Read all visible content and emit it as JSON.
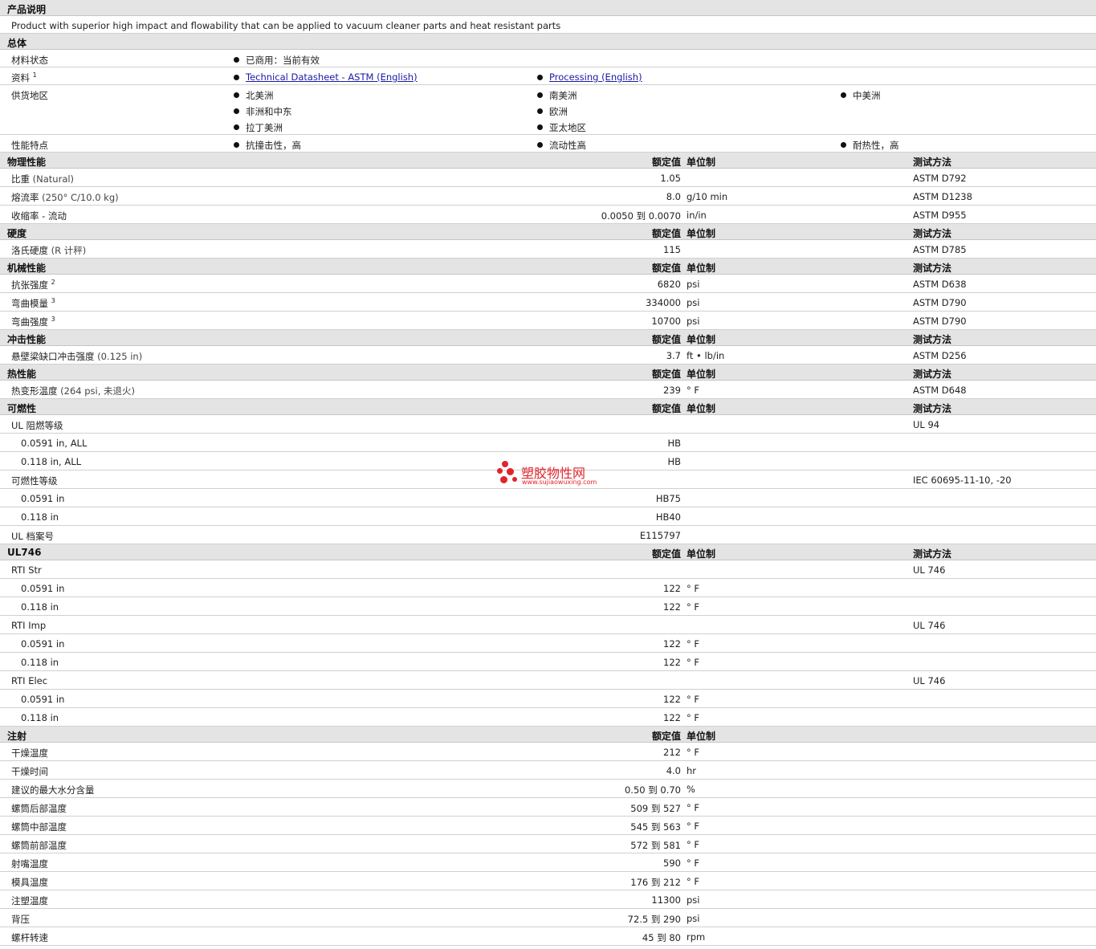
{
  "description": {
    "title": "产品说明",
    "text": "Product with superior high impact and flowability that can be applied to vacuum cleaner parts and heat resistant parts"
  },
  "general": {
    "title": "总体",
    "rows": [
      {
        "label": "材料状态",
        "sup": "",
        "items": [
          "已商用：当前有效"
        ],
        "links": false
      },
      {
        "label": "资料",
        "sup": "1",
        "items": [
          "Technical Datasheet - ASTM (English)",
          "Processing (English)"
        ],
        "links": true
      },
      {
        "label": "供货地区",
        "sup": "",
        "items": [
          "北美洲",
          "南美洲",
          "中美洲",
          "非洲和中东",
          "欧洲",
          "拉丁美洲",
          "亚太地区"
        ],
        "links": false,
        "order": [
          0,
          1,
          2,
          3,
          4,
          null,
          5,
          6
        ]
      },
      {
        "label": "性能特点",
        "sup": "",
        "items": [
          "抗撞击性，高",
          "流动性高",
          "耐热性，高"
        ],
        "links": false
      }
    ]
  },
  "columns": {
    "value": "额定值",
    "unit": "单位制",
    "method": "测试方法"
  },
  "sections": [
    {
      "title": "物理性能",
      "rows": [
        {
          "label": "比重",
          "note": "(Natural)",
          "value": "1.05",
          "unit": "",
          "method": "ASTM D792"
        },
        {
          "label": "熔流率",
          "note": "(250° C/10.0 kg)",
          "value": "8.0",
          "unit": "g/10 min",
          "method": "ASTM D1238"
        },
        {
          "label": "收缩率 - 流动",
          "note": "",
          "value": "0.0050 到 0.0070",
          "unit": "in/in",
          "method": "ASTM D955"
        }
      ]
    },
    {
      "title": "硬度",
      "rows": [
        {
          "label": "洛氏硬度",
          "note": "(R 计秤)",
          "value": "115",
          "unit": "",
          "method": "ASTM D785"
        }
      ]
    },
    {
      "title": "机械性能",
      "rows": [
        {
          "label": "抗张强度",
          "sup": "2",
          "value": "6820",
          "unit": "psi",
          "method": "ASTM D638"
        },
        {
          "label": "弯曲模量",
          "sup": "3",
          "value": "334000",
          "unit": "psi",
          "method": "ASTM D790"
        },
        {
          "label": "弯曲强度",
          "sup": "3",
          "value": "10700",
          "unit": "psi",
          "method": "ASTM D790"
        }
      ]
    },
    {
      "title": "冲击性能",
      "rows": [
        {
          "label": "悬壁梁缺口冲击强度",
          "note": "(0.125 in)",
          "value": "3.7",
          "unit": "ft • lb/in",
          "method": "ASTM D256"
        }
      ]
    },
    {
      "title": "热性能",
      "rows": [
        {
          "label": "热变形温度",
          "note": "(264 psi, 未退火)",
          "value": "239",
          "unit": "° F",
          "method": "ASTM D648"
        }
      ]
    },
    {
      "title": "可燃性",
      "rows": [
        {
          "label": "UL 阻燃等级",
          "value": "",
          "unit": "",
          "method": "UL 94"
        },
        {
          "label": "0.0591 in, ALL",
          "sub": true,
          "value": "HB",
          "unit": "",
          "method": ""
        },
        {
          "label": "0.118 in, ALL",
          "sub": true,
          "value": "HB",
          "unit": "",
          "method": ""
        },
        {
          "label": "可燃性等级",
          "value": "",
          "unit": "",
          "method": "IEC 60695-11-10, -20"
        },
        {
          "label": "0.0591 in",
          "sub": true,
          "value": "HB75",
          "unit": "",
          "method": ""
        },
        {
          "label": "0.118 in",
          "sub": true,
          "value": "HB40",
          "unit": "",
          "method": ""
        },
        {
          "label": "UL 档案号",
          "value": "E115797",
          "unit": "",
          "method": ""
        }
      ]
    },
    {
      "title": "UL746",
      "rows": [
        {
          "label": "RTI Str",
          "value": "",
          "unit": "",
          "method": "UL 746"
        },
        {
          "label": "0.0591 in",
          "sub": true,
          "value": "122",
          "unit": "° F",
          "method": ""
        },
        {
          "label": "0.118 in",
          "sub": true,
          "value": "122",
          "unit": "° F",
          "method": ""
        },
        {
          "label": "RTI Imp",
          "value": "",
          "unit": "",
          "method": "UL 746"
        },
        {
          "label": "0.0591 in",
          "sub": true,
          "value": "122",
          "unit": "° F",
          "method": ""
        },
        {
          "label": "0.118 in",
          "sub": true,
          "value": "122",
          "unit": "° F",
          "method": ""
        },
        {
          "label": "RTI Elec",
          "value": "",
          "unit": "",
          "method": "UL 746"
        },
        {
          "label": "0.0591 in",
          "sub": true,
          "value": "122",
          "unit": "° F",
          "method": ""
        },
        {
          "label": "0.118 in",
          "sub": true,
          "value": "122",
          "unit": "° F",
          "method": ""
        }
      ]
    },
    {
      "title": "注射",
      "noMethod": true,
      "rows": [
        {
          "label": "干燥温度",
          "value": "212",
          "unit": "° F"
        },
        {
          "label": "干燥时间",
          "value": "4.0",
          "unit": "hr"
        },
        {
          "label": "建议的最大水分含量",
          "value": "0.50 到 0.70",
          "unit": "%"
        },
        {
          "label": "螺筒后部温度",
          "value": "509 到 527",
          "unit": "° F"
        },
        {
          "label": "螺筒中部温度",
          "value": "545 到 563",
          "unit": "° F"
        },
        {
          "label": "螺筒前部温度",
          "value": "572 到 581",
          "unit": "° F"
        },
        {
          "label": "射嘴温度",
          "value": "590",
          "unit": "° F"
        },
        {
          "label": "模具温度",
          "value": "176 到 212",
          "unit": "° F"
        },
        {
          "label": "注塑温度",
          "value": "11300",
          "unit": "psi"
        },
        {
          "label": "背压",
          "value": "72.5 到 290",
          "unit": "psi"
        },
        {
          "label": "螺杆转速",
          "value": "45 到 80",
          "unit": "rpm"
        }
      ]
    }
  ],
  "watermark": {
    "name": "塑胶物性网",
    "url": "www.sujiaowuxing.com"
  }
}
